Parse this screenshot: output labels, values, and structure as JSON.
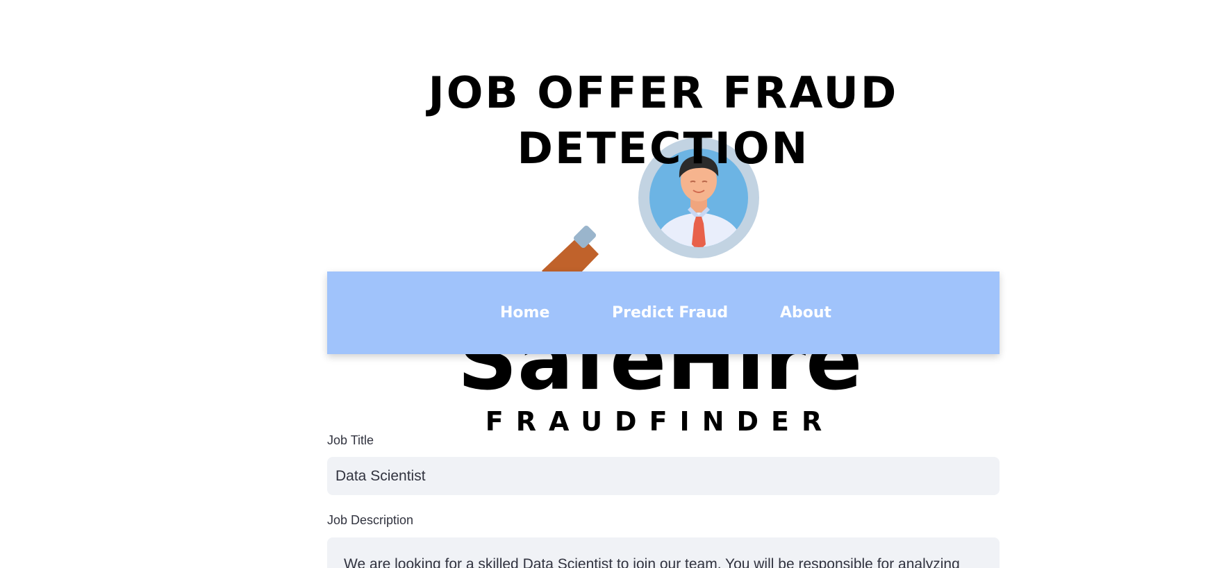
{
  "header": {
    "title": "JOB OFFER FRAUD DETECTION"
  },
  "logo": {
    "wordmark": "SafeHire",
    "tagline": "FRAUDFINDER",
    "icon": "magnifier-person-icon"
  },
  "nav": {
    "items": [
      {
        "label": "Home"
      },
      {
        "label": "Predict Fraud"
      },
      {
        "label": "About"
      }
    ]
  },
  "form": {
    "job_title": {
      "label": "Job Title",
      "value": "Data Scientist"
    },
    "job_description": {
      "label": "Job Description",
      "value": "We are looking for a skilled Data Scientist to join our team. You will be responsible for analyzing large"
    }
  },
  "colors": {
    "nav_background": "#a0c3fb",
    "input_background": "#f0f2f6",
    "handle": "#c0622b",
    "lens_ring": "#c2d3e2",
    "lens_inner": "#6cb4e4",
    "tie": "#e8614a"
  }
}
